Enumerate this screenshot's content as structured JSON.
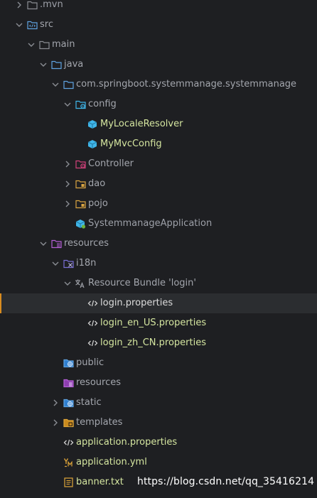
{
  "tree": {
    "mvn": ".mvn",
    "src": "src",
    "main": "main",
    "java": "java",
    "package": "com.springboot.systemmanage.systemmanage",
    "config": "config",
    "my_locale_resolver": "MyLocaleResolver",
    "my_mvc_config": "MyMvcConfig",
    "controller": "Controller",
    "dao": "dao",
    "pojo": "pojo",
    "app_class": "SystemmanageApplication",
    "resources": "resources",
    "i18n": "i18n",
    "resource_bundle": "Resource Bundle 'login'",
    "login_properties": "login.properties",
    "login_en_us": "login_en_US.properties",
    "login_zh_cn": "login_zh_CN.properties",
    "public": "public",
    "resources2": "resources",
    "static": "static",
    "templates": "templates",
    "application_properties": "application.properties",
    "application_yml": "application.yml",
    "banner": "banner.txt"
  },
  "watermark": "https://blog.csdn.net/qq_35416214",
  "colors": {
    "background": "#1e1f22",
    "selected_row": "#2b2d30",
    "selection_accent": "#d98c1f",
    "folder_blue": "#5fa2e0",
    "folder_gray": "#8a8d93",
    "java_class": "#3fb5e8",
    "text_green": "#d5e6a0"
  }
}
